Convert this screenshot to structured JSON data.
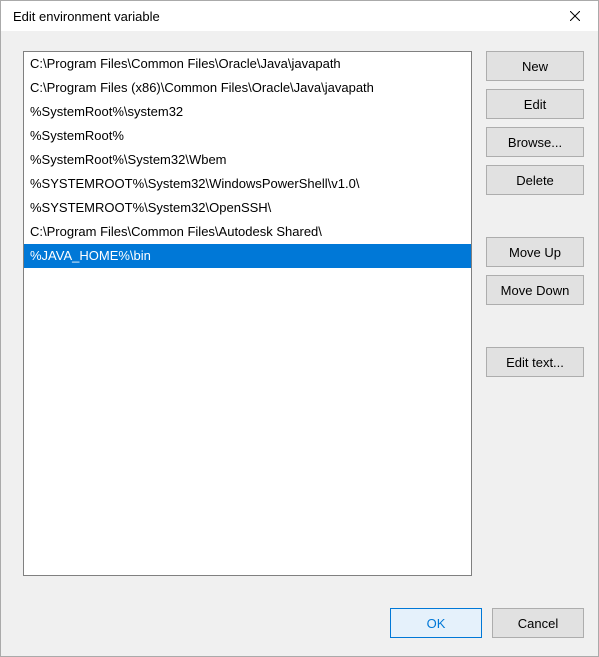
{
  "dialog": {
    "title": "Edit environment variable"
  },
  "list": {
    "items": [
      {
        "value": "C:\\Program Files\\Common Files\\Oracle\\Java\\javapath",
        "selected": false
      },
      {
        "value": "C:\\Program Files (x86)\\Common Files\\Oracle\\Java\\javapath",
        "selected": false
      },
      {
        "value": "%SystemRoot%\\system32",
        "selected": false
      },
      {
        "value": "%SystemRoot%",
        "selected": false
      },
      {
        "value": "%SystemRoot%\\System32\\Wbem",
        "selected": false
      },
      {
        "value": "%SYSTEMROOT%\\System32\\WindowsPowerShell\\v1.0\\",
        "selected": false
      },
      {
        "value": "%SYSTEMROOT%\\System32\\OpenSSH\\",
        "selected": false
      },
      {
        "value": "C:\\Program Files\\Common Files\\Autodesk Shared\\",
        "selected": false
      },
      {
        "value": "%JAVA_HOME%\\bin",
        "selected": true
      }
    ]
  },
  "buttons": {
    "new": "New",
    "edit": "Edit",
    "browse": "Browse...",
    "delete": "Delete",
    "move_up": "Move Up",
    "move_down": "Move Down",
    "edit_text": "Edit text...",
    "ok": "OK",
    "cancel": "Cancel"
  }
}
